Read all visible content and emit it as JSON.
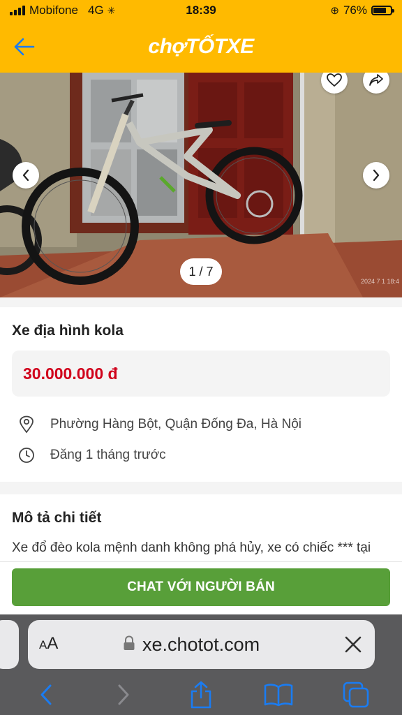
{
  "status_bar": {
    "carrier": "Mobifone",
    "network": "4G",
    "time": "18:39",
    "battery": "76%",
    "battery_level": 0.76
  },
  "header": {
    "logo": "chợTỐTXE",
    "back_icon": "arrow-left-icon"
  },
  "gallery": {
    "counter": "1 / 7",
    "watermark": "2024 7 1 18:4",
    "icons": [
      "heart-icon",
      "share-icon",
      "chevron-left-icon",
      "chevron-right-icon"
    ]
  },
  "listing": {
    "title": "Xe địa hình kola",
    "price": "30.000.000 đ",
    "location": "Phường Hàng Bột, Quận Đống Đa, Hà Nội",
    "posted": "Đăng 1 tháng trước"
  },
  "description": {
    "heading": "Mô tả chi tiết",
    "text": "Xe đổ đèo kola mệnh danh không phá hủy, xe có chiếc *** tại"
  },
  "chat": {
    "label": "CHAT VỚI NGƯỜI BÁN"
  },
  "browser": {
    "aa_small": "A",
    "aa_large": "A",
    "url": "xe.chotot.com"
  },
  "colors": {
    "brand_yellow": "#ffba00",
    "price_red": "#d0021b",
    "chat_green": "#589f39",
    "ios_blue": "#1a7cf2"
  }
}
